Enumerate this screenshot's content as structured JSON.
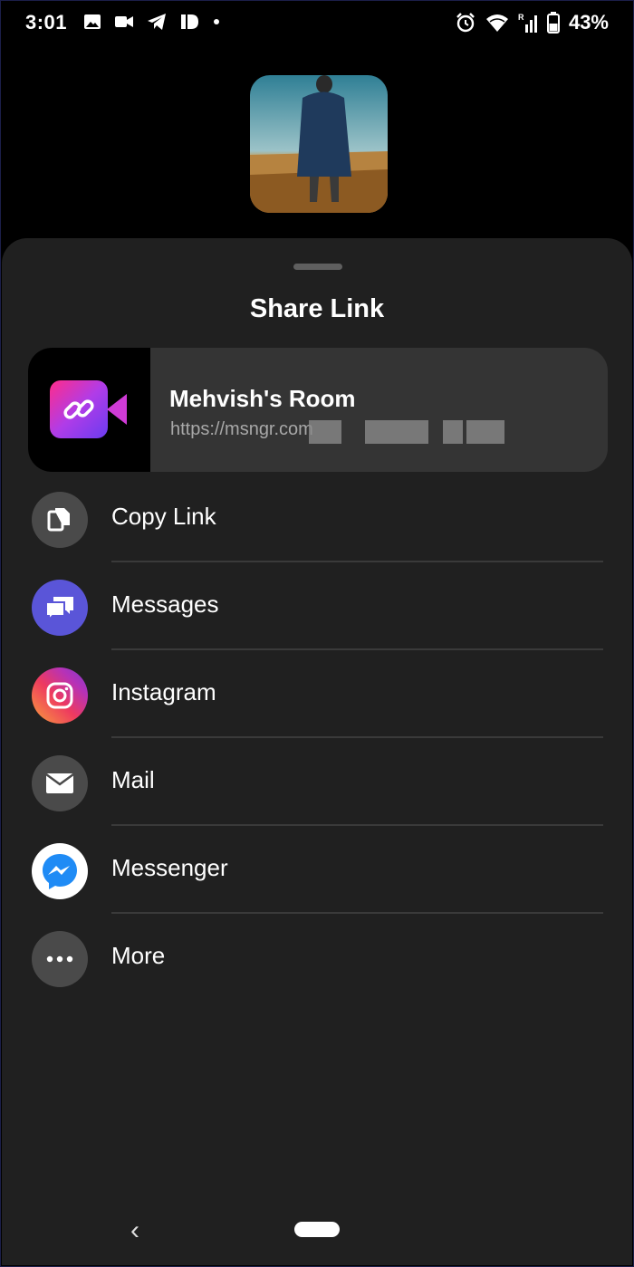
{
  "status_bar": {
    "time": "3:01",
    "battery": "43%",
    "left_icons": [
      "image-icon",
      "video-icon",
      "telegram-icon",
      "id-icon",
      "dot-icon"
    ],
    "right_icons": [
      "alarm-icon",
      "wifi-icon",
      "signal-icon",
      "battery-icon"
    ]
  },
  "sheet": {
    "title": "Share Link",
    "link_card": {
      "name": "Mehvish's Room",
      "url": "https://msngr.com"
    },
    "items": [
      {
        "label": "Copy Link",
        "icon": "copy-icon",
        "bg": "#4a4a4a"
      },
      {
        "label": "Messages",
        "icon": "messages-icon",
        "bg": "#5a55d8"
      },
      {
        "label": "Instagram",
        "icon": "instagram-icon",
        "bg": "gradient"
      },
      {
        "label": "Mail",
        "icon": "mail-icon",
        "bg": "#4a4a4a"
      },
      {
        "label": "Messenger",
        "icon": "messenger-icon",
        "bg": "#ffffff"
      },
      {
        "label": "More",
        "icon": "more-icon",
        "bg": "#4a4a4a"
      }
    ]
  },
  "nav_bar": {
    "back_glyph": "‹"
  }
}
